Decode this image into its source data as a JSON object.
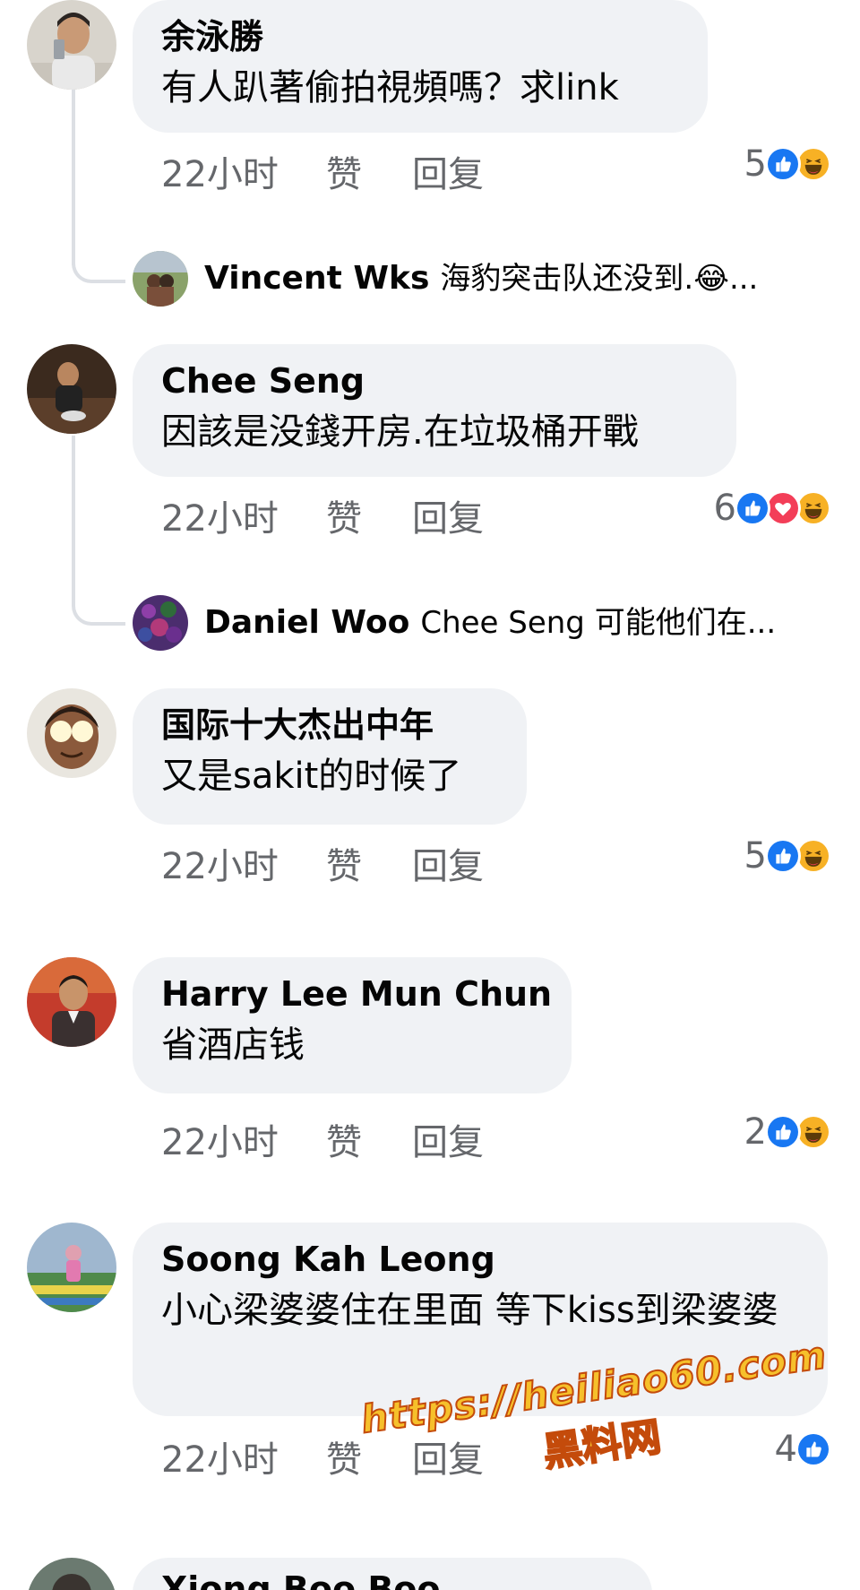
{
  "comments": [
    {
      "author": "余泳勝",
      "text": "有人趴著偷拍視頻嗎？求link",
      "time": "22小时",
      "like": "赞",
      "reply": "回复",
      "reaction_count": "5",
      "reactions": [
        "like",
        "haha"
      ],
      "reply_preview": {
        "author": "Vincent Wks",
        "text": "海豹突击队还没到.😂..."
      }
    },
    {
      "author": "Chee Seng",
      "text": "因該是没錢开房.在垃圾桶开戰",
      "time": "22小时",
      "like": "赞",
      "reply": "回复",
      "reaction_count": "6",
      "reactions": [
        "like",
        "love",
        "haha"
      ],
      "reply_preview": {
        "author": "Daniel Woo",
        "text": "Chee Seng 可能他们在..."
      }
    },
    {
      "author": "国际十大杰出中年",
      "text": "又是sakit的时候了",
      "time": "22小时",
      "like": "赞",
      "reply": "回复",
      "reaction_count": "5",
      "reactions": [
        "like",
        "haha"
      ]
    },
    {
      "author": "Harry Lee Mun Chun",
      "text": "省酒店钱",
      "time": "22小时",
      "like": "赞",
      "reply": "回复",
      "reaction_count": "2",
      "reactions": [
        "like",
        "haha"
      ]
    },
    {
      "author": "Soong Kah Leong",
      "text": "小心梁婆婆住在里面 等下kiss到梁婆婆",
      "time": "22小时",
      "like": "赞",
      "reply": "回复",
      "reaction_count": "4",
      "reactions": [
        "like"
      ]
    },
    {
      "author": "Xiong Boo Boo",
      "text": ""
    }
  ],
  "watermark": {
    "url": "https://heiliao60.com",
    "name": "黑料网"
  },
  "colors": {
    "like_blue": "#1877f2",
    "love_red": "#f33e58",
    "haha_yellow": "#f7b125",
    "bubble_bg": "#f0f2f5",
    "meta_gray": "#65676b"
  }
}
